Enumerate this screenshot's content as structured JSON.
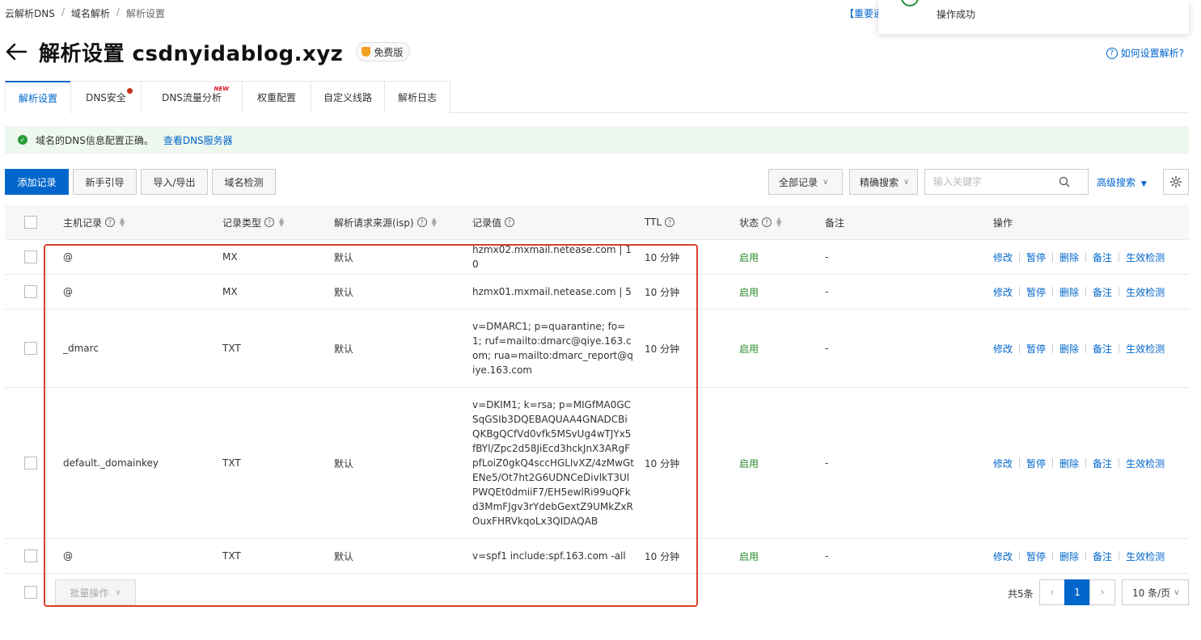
{
  "breadcrumb": [
    "云解析DNS",
    "域名解析",
    "解析设置"
  ],
  "notice_link": "【重要通",
  "toast": {
    "message": "操作成功"
  },
  "page": {
    "title": "解析设置 csdnyidablog.xyz",
    "badge": "免费版",
    "help_link": "如何设置解析?"
  },
  "tabs": [
    {
      "label": "解析设置",
      "active": true
    },
    {
      "label": "DNS安全",
      "dot": true
    },
    {
      "label": "DNS流量分析",
      "new": "NEW"
    },
    {
      "label": "权重配置"
    },
    {
      "label": "自定义线路"
    },
    {
      "label": "解析日志"
    }
  ],
  "status_bar": {
    "text": "域名的DNS信息配置正确。",
    "link": "查看DNS服务器",
    "color": "#2a9d3a"
  },
  "toolbar": {
    "add_record": "添加记录",
    "guide": "新手引导",
    "import_export": "导入/导出",
    "domain_check": "域名检测",
    "record_filter": "全部记录",
    "search_mode": "精确搜索",
    "search_placeholder": "输入关键字",
    "advanced_search": "高级搜索"
  },
  "table": {
    "headers": {
      "host": "主机记录",
      "type": "记录类型",
      "line": "解析请求来源(isp)",
      "value": "记录值",
      "ttl": "TTL",
      "status": "状态",
      "remark": "备注",
      "actions": "操作"
    },
    "actions": [
      "修改",
      "暂停",
      "删除",
      "备注",
      "生效检测"
    ],
    "rows": [
      {
        "host": "@",
        "type": "MX",
        "line": "默认",
        "value": "hzmx02.mxmail.netease.com | 10",
        "ttl": "10 分钟",
        "status": "启用",
        "remark": "-"
      },
      {
        "host": "@",
        "type": "MX",
        "line": "默认",
        "value": "hzmx01.mxmail.netease.com | 5",
        "ttl": "10 分钟",
        "status": "启用",
        "remark": "-"
      },
      {
        "host": "_dmarc",
        "type": "TXT",
        "line": "默认",
        "value": "v=DMARC1; p=quarantine; fo=1; ruf=mailto:dmarc@qiye.163.com; rua=mailto:dmarc_report@qiye.163.com",
        "ttl": "10 分钟",
        "status": "启用",
        "remark": "-"
      },
      {
        "host": "default._domainkey",
        "type": "TXT",
        "line": "默认",
        "value": "v=DKIM1; k=rsa; p=MIGfMA0GCSqGSIb3DQEBAQUAA4GNADCBiQKBgQCfVd0vfk5MSvUg4wTJYx5fBYl/Zpc2d58JiEcd3hckJnX3ARgFpfLoiZ0gkQ4sccHGLlvXZ/4zMwGtENe5/Ot7ht2G6UDNCeDivlkT3UlPWQEt0dmiiF7/EH5ewlRi99uQFkd3MmFJgv3rYdebGextZ9UMkZxROuxFHRVkqoLx3QIDAQAB",
        "ttl": "10 分钟",
        "status": "启用",
        "remark": "-"
      },
      {
        "host": "@",
        "type": "TXT",
        "line": "默认",
        "value": "v=spf1 include:spf.163.com -all",
        "ttl": "10 分钟",
        "status": "启用",
        "remark": "-"
      }
    ]
  },
  "footer": {
    "batch": "批量操作",
    "total": "共5条",
    "current_page": "1",
    "page_size": "10 条/页"
  },
  "colors": {
    "accent": "#0066cc",
    "status_on": "#2a8a2a",
    "highlight": "#d9412a"
  }
}
